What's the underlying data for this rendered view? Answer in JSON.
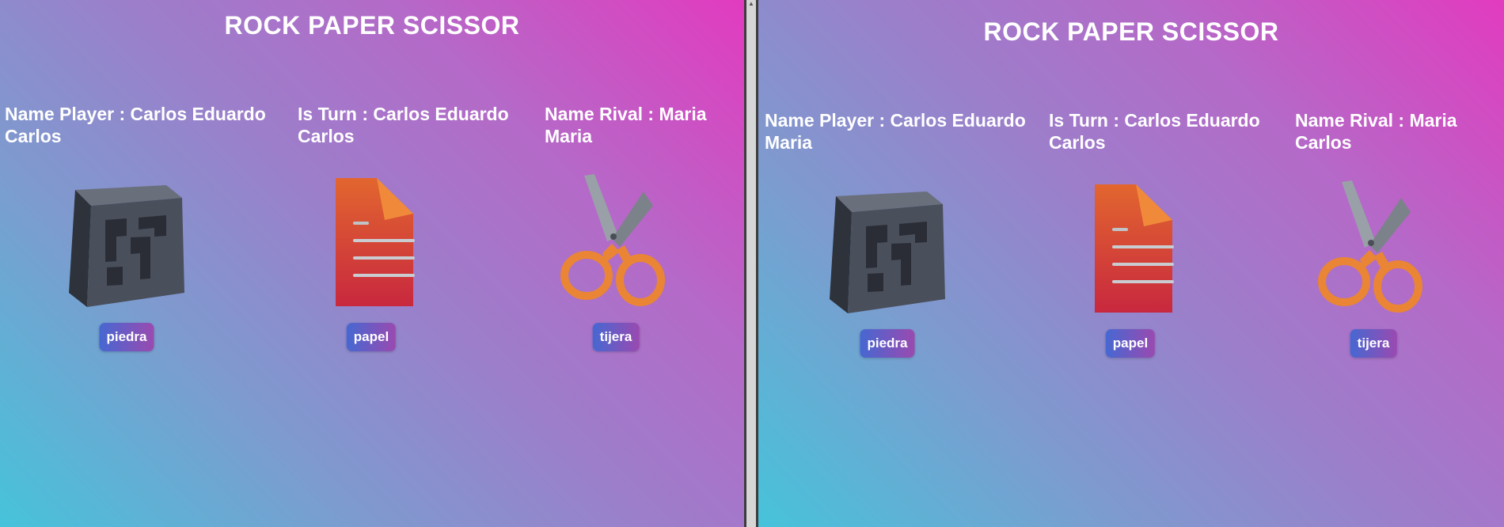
{
  "game_title": "ROCK PAPER SCISSOR",
  "labels": {
    "player": "Name Player : ",
    "turn": "Is Turn : ",
    "rival": "Name Rival : "
  },
  "left": {
    "player_name": "Carlos Eduardo Carlos",
    "turn_name": "Carlos Eduardo Carlos",
    "rival_name": "Maria Maria"
  },
  "right": {
    "player_name": "Carlos Eduardo Maria",
    "turn_name": "Carlos Eduardo Carlos",
    "rival_name": "Maria Carlos"
  },
  "choices": {
    "rock": "piedra",
    "paper": "papel",
    "scissor": "tijera"
  },
  "icons": {
    "rock": "rock-cube-icon",
    "paper": "paper-document-icon",
    "scissor": "scissors-icon"
  },
  "colors": {
    "gradient_top_right": "#e23bbf",
    "gradient_bottom_left": "#46c3da",
    "button_start": "#4668d2",
    "button_end": "#9a4ab0"
  }
}
